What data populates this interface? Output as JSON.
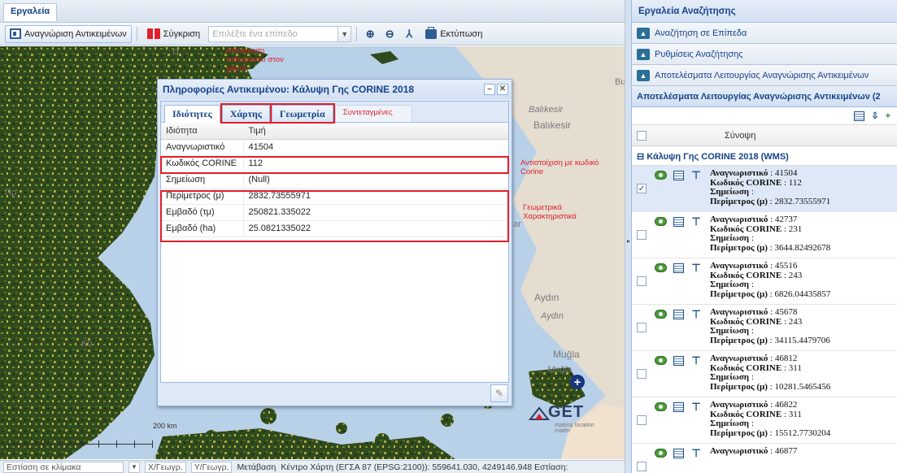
{
  "tools_tab": "Εργαλεία",
  "toolbar": {
    "identify_label": "Αναγνώριση Αντικειμένων",
    "compare_label": "Σύγκριση",
    "layer_placeholder": "Επιλέξτε ένα επίπεδο",
    "print_label": "Εκτύπωση"
  },
  "map_labels": {
    "balikesir_1": "Balıkesir",
    "balikesir_2": "Balıkesir",
    "aydin_1": "Aydın",
    "aydin_2": "Aydın",
    "mugla_1": "Muğla",
    "mugla_2": "Muğla",
    "bu": "Bu",
    "ar": "ar",
    "kv": "Κυ",
    "pr": "Πρ",
    "pi": "Π",
    "scale": "200 km"
  },
  "annotations": {
    "polygon": "Απεικόνιση πολυγώνου στον χάρτη",
    "corine_match": "Αντιστοίχιση με κωδικό Corine",
    "geometric": "Γεωμετρικά Χαρακτηριστικά"
  },
  "logo": {
    "text": "GET",
    "tagline": "making location matter"
  },
  "popup": {
    "title": "Πληροφορίες Αντικειμένου: Κάλυψη Γης CORINE 2018",
    "tabs": [
      "Ιδιότητες",
      "Χάρτης",
      "Γεωμετρία",
      "Συντεταγμένες"
    ],
    "header": {
      "prop": "Ιδιότητα",
      "val": "Τιμή"
    },
    "rows": [
      {
        "prop": "Αναγνωριστικό",
        "val": "41504"
      },
      {
        "prop": "Κωδικός CORINE",
        "val": "112"
      },
      {
        "prop": "Σημείωση",
        "val": "(Null)"
      },
      {
        "prop": "Περίμετρος (μ)",
        "val": "2832.73555971"
      },
      {
        "prop": "Εμβαδό (τμ)",
        "val": "250821.335022"
      },
      {
        "prop": "Εμβαδό (ha)",
        "val": "25.0821335022"
      }
    ]
  },
  "status": {
    "scale_focus": "Εστίαση σε κλίμακα",
    "x_label": "Χ/Γεωγρ.",
    "y_label": "Υ/Γεωγρ.",
    "goto": "Μετάβαση",
    "center": "Κέντρο Χάρτη (ΕΓΣΑ 87 (EPSG:2100)): 559641.030, 4249146.948 Εστίαση:"
  },
  "right": {
    "header": "Εργαλεία Αναζήτησης",
    "accordion": [
      "Αναζήτηση σε Επίπεδα",
      "Ρυθμίσεις Αναζήτησης",
      "Αποτελέσματα Λειτουργίας Αναγνώρισης Αντικειμένων"
    ],
    "results_title": "Αποτελέσματα Λειτουργίας Αναγνώρισης Αντικειμένων (2",
    "col_summary": "Σύνοψη",
    "group": "Κάλυψη Γης CORINE 2018 (WMS)",
    "field_labels": {
      "id": "Αναγνωριστικό",
      "code": "Κωδικός CORINE",
      "note": "Σημείωση",
      "perim": "Περίμετρος (μ)"
    },
    "results": [
      {
        "id": "41504",
        "code": "112",
        "perim": "2832.73555971"
      },
      {
        "id": "42737",
        "code": "231",
        "perim": "3644.82492678"
      },
      {
        "id": "45516",
        "code": "243",
        "perim": "6826.04435857"
      },
      {
        "id": "45678",
        "code": "243",
        "perim": "34115.4479706"
      },
      {
        "id": "46812",
        "code": "311",
        "perim": "10281.5465456"
      },
      {
        "id": "46822",
        "code": "311",
        "perim": "15512.7730204"
      },
      {
        "id": "46877"
      }
    ]
  }
}
